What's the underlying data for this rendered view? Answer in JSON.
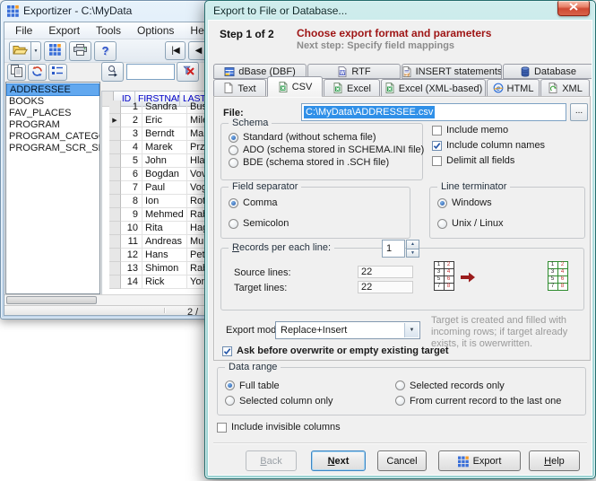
{
  "main_window": {
    "title": "Exportizer - C:\\MyData",
    "menu_items": [
      "File",
      "Export",
      "Tools",
      "Options",
      "Help"
    ],
    "toolbar_buttons": [
      {
        "icon": "folder-open",
        "name": "open-button",
        "split": true
      },
      {
        "icon": "app-grid",
        "name": "export-button"
      },
      {
        "icon": "printer",
        "name": "print-button"
      },
      {
        "icon": "question-mark",
        "name": "help-button"
      }
    ],
    "nav_buttons": [
      {
        "icon": "nav-first",
        "name": "first-record-button",
        "glyph": "|◀"
      },
      {
        "icon": "nav-prev",
        "name": "prev-record-button",
        "glyph": "◀"
      }
    ],
    "left_toolbar_buttons": [
      {
        "icon": "copy",
        "name": "copy-button"
      },
      {
        "icon": "refresh",
        "name": "refresh-button"
      },
      {
        "icon": "field-list",
        "name": "fields-button"
      }
    ],
    "search": {
      "value": "",
      "button_icon": "search-arrow",
      "clear_icon": "clear-filter"
    },
    "tables": [
      "ADDRESSEE",
      "BOOKS",
      "FAV_PLACES",
      "PROGRAM",
      "PROGRAM_CATEGORY",
      "PROGRAM_SCR_SHOT"
    ],
    "selected_table": "ADDRESSEE",
    "grid": {
      "columns": [
        "ID",
        "FIRSTNAME",
        "LASTNAME"
      ],
      "current_row": 2,
      "current_row_marker": "▶",
      "rows": [
        [
          "1",
          "Sandra",
          "Bush"
        ],
        [
          "2",
          "Eric",
          "Miles"
        ],
        [
          "3",
          "Berndt",
          "Mann"
        ],
        [
          "4",
          "Marek",
          "Przyby"
        ],
        [
          "5",
          "John",
          "Hladni"
        ],
        [
          "6",
          "Bogdan",
          "Vovch"
        ],
        [
          "7",
          "Paul",
          "Vogel"
        ],
        [
          "8",
          "Ion",
          "Rotaru"
        ],
        [
          "9",
          "Mehmed",
          "Rabba"
        ],
        [
          "10",
          "Rita",
          "Hagen"
        ],
        [
          "11",
          "Andreas",
          "Muller"
        ],
        [
          "12",
          "Hans",
          "Peters"
        ],
        [
          "13",
          "Shimon",
          "Rabino"
        ],
        [
          "14",
          "Rick",
          "Yonley"
        ]
      ]
    },
    "status_right": "2 /"
  },
  "dialog": {
    "title": "Export to File or Database...",
    "close_icon": "close-x",
    "step": "Step 1 of 2",
    "heading": "Choose export format and parameters",
    "subheading": "Next step: Specify field mappings",
    "heading_color": "#9e1414",
    "tabs_back": [
      {
        "label": "dBase (DBF)",
        "icon": "db-grid"
      },
      {
        "label": "RTF",
        "icon": "doc-word"
      },
      {
        "label": "INSERT statements",
        "icon": "doc-sql"
      },
      {
        "label": "Database",
        "icon": "database-cyl"
      }
    ],
    "tabs_front": [
      {
        "label": "Text",
        "icon": "doc-blank"
      },
      {
        "label": "CSV",
        "icon": "doc-excel",
        "active": true
      },
      {
        "label": "Excel",
        "icon": "doc-excel"
      },
      {
        "label": "Excel (XML-based)",
        "icon": "doc-excel"
      },
      {
        "label": "HTML",
        "icon": "ie"
      },
      {
        "label": "XML",
        "icon": "doc-xml"
      }
    ],
    "file_label": "File:",
    "file_value": "C:\\MyData\\ADDRESSEE.csv",
    "browse_label": "...",
    "schema": {
      "caption": "Schema",
      "selected": 0,
      "options": [
        "Standard (without schema file)",
        "ADO (schema stored in SCHEMA.INI file)",
        "BDE (schema stored in .SCH file)"
      ]
    },
    "options": [
      {
        "label": "Include memo",
        "checked": false
      },
      {
        "label": "Include column names",
        "checked": true
      },
      {
        "label": "Delimit all fields",
        "checked": false
      }
    ],
    "field_separator": {
      "caption": "Field separator",
      "selected": 0,
      "options": [
        "Comma",
        "Semicolon"
      ]
    },
    "line_terminator": {
      "caption": "Line terminator",
      "selected": 0,
      "options": [
        "Windows",
        "Unix / Linux"
      ]
    },
    "records": {
      "caption": "Records per each line:",
      "value": "1",
      "source_label": "Source lines:",
      "source_value": "22",
      "target_label": "Target lines:",
      "target_value": "22",
      "grid_numbers": [
        "1",
        "2",
        "3",
        "4",
        "5",
        "6",
        "7",
        "8"
      ],
      "arrow_icon": "red-arrow"
    },
    "export_mode": {
      "label": "Export mode:",
      "value": "Replace+Insert",
      "note": "Target is created and filled with incoming rows; if target already exists, it is owerwritten."
    },
    "ask_overwrite": {
      "label": "Ask before overwrite or empty existing target",
      "checked": true
    },
    "data_range": {
      "caption": "Data range",
      "selected": 0,
      "options": [
        "Full table",
        "Selected column only",
        "Selected records only",
        "From current record to the last one"
      ]
    },
    "include_invisible": {
      "label": "Include invisible columns",
      "checked": false
    },
    "buttons": [
      {
        "label": "Back",
        "disabled": true,
        "accel": true
      },
      {
        "label": "Next",
        "default": true,
        "accel": true
      },
      {
        "label": "Cancel"
      },
      {
        "label": "Export",
        "icon": "app-grid"
      },
      {
        "label": "Help",
        "accel": true
      }
    ]
  }
}
